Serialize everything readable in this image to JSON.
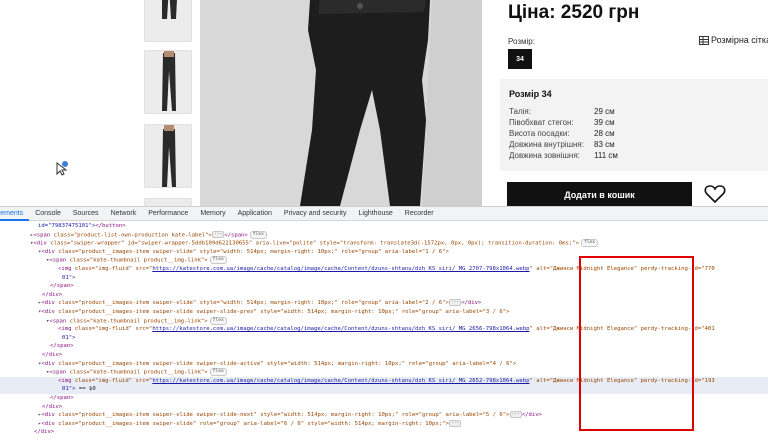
{
  "product": {
    "price": "Ціна: 2520 грн",
    "size_label": "Розмір:",
    "size_guide": "Розмірна сітка",
    "selected_size": "34",
    "add_to_cart": "Додати в кошик"
  },
  "size_card": {
    "title": "Розмір 34",
    "rows": [
      {
        "label": "Талія:",
        "value": "29 см"
      },
      {
        "label": "Півобхват стегон:",
        "value": "39 см"
      },
      {
        "label": "Висота посадки:",
        "value": "28 см"
      },
      {
        "label": "Довжина внутрішня:",
        "value": "83 см"
      },
      {
        "label": "Довжина зовнішня:",
        "value": "111 см"
      }
    ]
  },
  "devtools": {
    "tabs": [
      "Elements",
      "Console",
      "Sources",
      "Network",
      "Performance",
      "Memory",
      "Application",
      "Privacy and security",
      "Lighthouse",
      "Recorder"
    ],
    "active_tab": "Elements",
    "badge_flex": "flex",
    "dom_eq": "== $0",
    "dom": {
      "l0": "id=\"79837475101\">",
      "l0b": "</button>",
      "l1_tag": "span",
      "l1_attrs": "class=\"product-list-own-production kate-label\">",
      "l1_end": "</span>",
      "l2_text": "class=\"swiper-wrapper\" id=\"swiper-wrapper-5ddb109d622130655\" aria-live=\"polite\" style=\"transform: translate3d(-1572px, 0px, 0px); transition-duration: 0ms;\">",
      "l3_text": "class=\"product__images-item swiper-slide\" style=\"width: 514px; margin-right: 10px;\" role=\"group\" aria-label=\"1 / 6\">",
      "l4_text": "class=\"kate-thumbnail product__img-link\">",
      "img_class": "class=\"img-fluid\" src=\"",
      "src1": "https://katestore.com.ua/image/cache/catalog/image/cache/Content/dzuns-shtanu/dzh KS siri/ MG 2707-798x1064.webp",
      "src2": "https://katestore.com.ua/image/cache/catalog/image/cache/Content/dzuns-shtanu/dzh KS siri/ MG 2656-798x1064.webp",
      "src3": "https://katestore.com.ua/image/cache/catalog/image/cache/Content/dzuns-shtanu/dzh KS siri/ MG 2652-798x1064.webp",
      "alt": "alt=\"Джинси Midnight Elegance\"",
      "tracking1": "perdy-tracking-id=\"770",
      "tracking2": "perdy-tracking-id=\"401",
      "tracking3": "perdy-tracking-id=\"193",
      "cont1": "01\">",
      "cont2": "01\">",
      "cont3": "01\">",
      "close_span": "</span>",
      "close_div": "</div>",
      "slide2": "class=\"product__images-item swiper-slide\" style=\"width: 514px; margin-right: 10px;\" role=\"group\" aria-label=\"2 / 6\">",
      "slide3": "class=\"product__images-item swiper-slide swiper-slide-prev\" style=\"width: 514px; margin-right: 10px;\" role=\"group\" aria-label=\"3 / 6\">",
      "slide4": "class=\"product__images-item swiper-slide swiper-slide-active\" style=\"width: 514px; margin-right: 10px;\" role=\"group\" aria-label=\"4 / 6\">",
      "slide5": "class=\"product__images-item swiper-slide swiper-slide-next\" style=\"width: 514px; margin-right: 10px;\" role=\"group\" aria-label=\"5 / 6\">",
      "slide6": "class=\"product__images-item swiper-slide\" role=\"group\" aria-label=\"6 / 6\" style=\"width: 514px; margin-right: 10px;\">",
      "last": "</div>"
    }
  },
  "colors": {
    "highlight": "#e00000",
    "accent": "#1a73e8",
    "button": "#111111"
  }
}
